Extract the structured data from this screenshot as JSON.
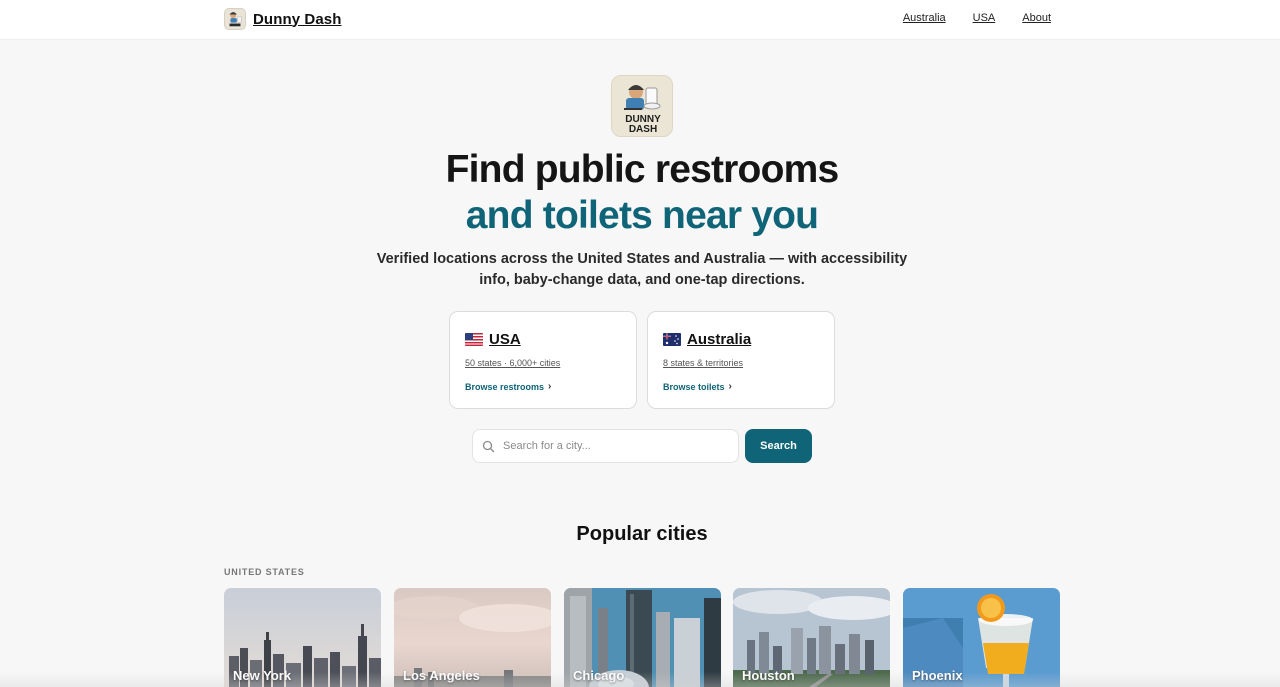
{
  "header": {
    "brand": "Dunny Dash",
    "nav": [
      "Australia",
      "USA",
      "About"
    ]
  },
  "hero": {
    "logo_text_1": "DUNNY",
    "logo_text_2": "DASH",
    "title_line1": "Find public restrooms",
    "title_line2": "and toilets near you",
    "subtitle": "Verified locations across the United States and Australia — with accessibility info, baby-change data, and one-tap directions."
  },
  "countries": [
    {
      "flag": "us-flag-icon",
      "name": "USA",
      "meta": "50 states · 6,000+ cities",
      "link": "Browse restrooms"
    },
    {
      "flag": "au-flag-icon",
      "name": "Australia",
      "meta": "8 states & territories",
      "link": "Browse toilets"
    }
  ],
  "search": {
    "placeholder": "Search for a city...",
    "button": "Search"
  },
  "popular": {
    "title": "Popular cities",
    "section_label": "UNITED STATES",
    "cities": [
      "New York",
      "Los Angeles",
      "Chicago",
      "Houston",
      "Phoenix"
    ]
  },
  "colors": {
    "accent": "#0f6478",
    "background": "#f7f7f7"
  }
}
